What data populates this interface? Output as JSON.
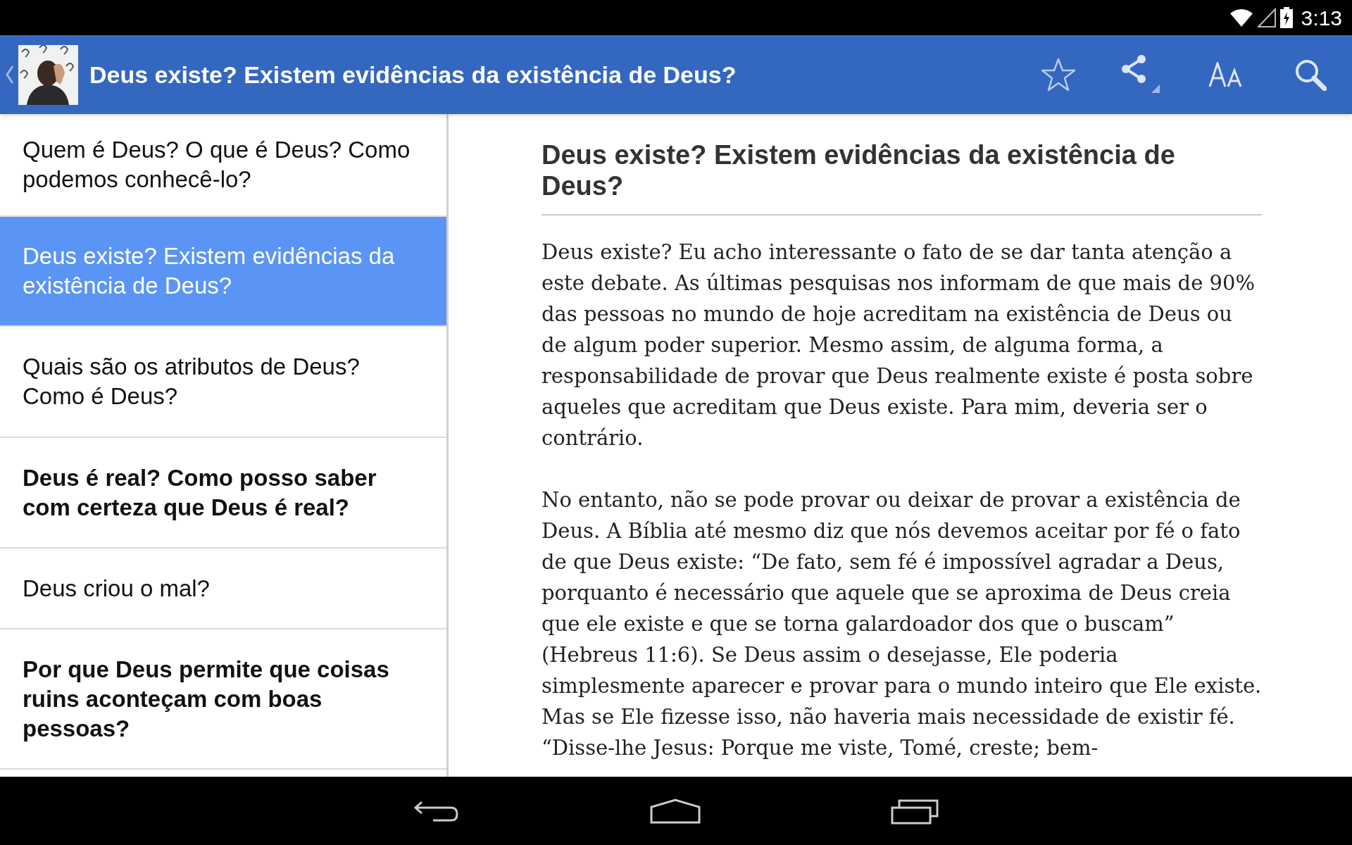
{
  "status_bar": {
    "time": "3:13"
  },
  "app_bar": {
    "title": "Deus existe? Existem evidências da existência de Deus?"
  },
  "list": [
    {
      "title": "Quem é Deus? O que é Deus? Como podemos conhecê-lo?",
      "selected": false,
      "unread": false
    },
    {
      "title": "Deus existe? Existem evidências da existência de Deus?",
      "selected": true,
      "unread": false
    },
    {
      "title": "Quais são os atributos de Deus? Como é Deus?",
      "selected": false,
      "unread": false
    },
    {
      "title": "Deus é real? Como posso saber com certeza que Deus é real?",
      "selected": false,
      "unread": true
    },
    {
      "title": "Deus criou o mal?",
      "selected": false,
      "unread": false
    },
    {
      "title": "Por que Deus permite que coisas ruins aconteçam com boas pessoas?",
      "selected": false,
      "unread": true
    }
  ],
  "article": {
    "heading": "Deus existe? Existem evidências da existência de Deus?",
    "paragraphs": [
      "Deus existe? Eu acho interessante o fato de se dar tanta atenção a este debate. As últimas pesquisas nos informam de que mais de 90% das pessoas no mundo de hoje acreditam na existência de Deus ou de algum poder superior. Mesmo assim, de alguma forma, a responsabilidade de provar que Deus realmente existe é posta sobre aqueles que acreditam que Deus existe. Para mim, deveria ser o contrário.",
      "No entanto, não se pode provar ou deixar de provar a existência de Deus. A Bíblia até mesmo diz que nós devemos aceitar por fé o fato de que Deus existe: “De fato, sem fé é impossível agradar a Deus, porquanto é necessário que aquele que se aproxima de Deus creia que ele existe e que se torna galardoador dos que o buscam” (Hebreus 11:6). Se Deus assim o desejasse, Ele poderia simplesmente aparecer e provar para o mundo inteiro que Ele existe. Mas se Ele fizesse isso, não haveria mais necessidade de existir fé. “Disse-lhe Jesus: Porque me viste, Tomé, creste; bem-"
    ]
  }
}
